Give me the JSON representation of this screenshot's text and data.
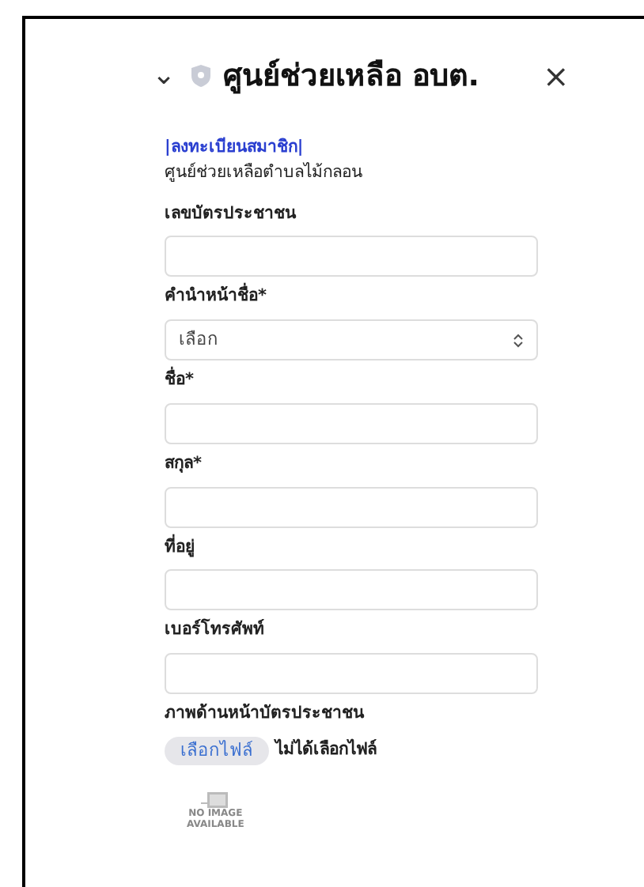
{
  "header": {
    "title": "ศูนย์ช่วยเหลือ อบต.",
    "collapse_glyph": "⌄",
    "close_glyph": "×"
  },
  "form": {
    "register_link": "|ลงทะเบียนสมาชิก|",
    "subtitle": "ศูนย์ช่วยเหลือตำบลไม้กลอน",
    "fields": [
      {
        "kind": "text",
        "label": "เลขบัตรประชาชน"
      },
      {
        "kind": "select",
        "label": "คำนำหน้าชื่อ*",
        "value": "เลือก"
      },
      {
        "kind": "text",
        "label": "ชื่อ*"
      },
      {
        "kind": "text",
        "label": "สกุล*"
      },
      {
        "kind": "text",
        "label": "ที่อยู่"
      },
      {
        "kind": "text",
        "label": "เบอร์โทรศัพท์"
      },
      {
        "kind": "file",
        "label": "ภาพด้านหน้าบัตรประชาชน",
        "button": "เลือกไฟล์",
        "status": "ไม่ได้เลือกไฟล์"
      }
    ],
    "no_image": [
      "NO IMAGE",
      "AVAILABLE"
    ]
  }
}
